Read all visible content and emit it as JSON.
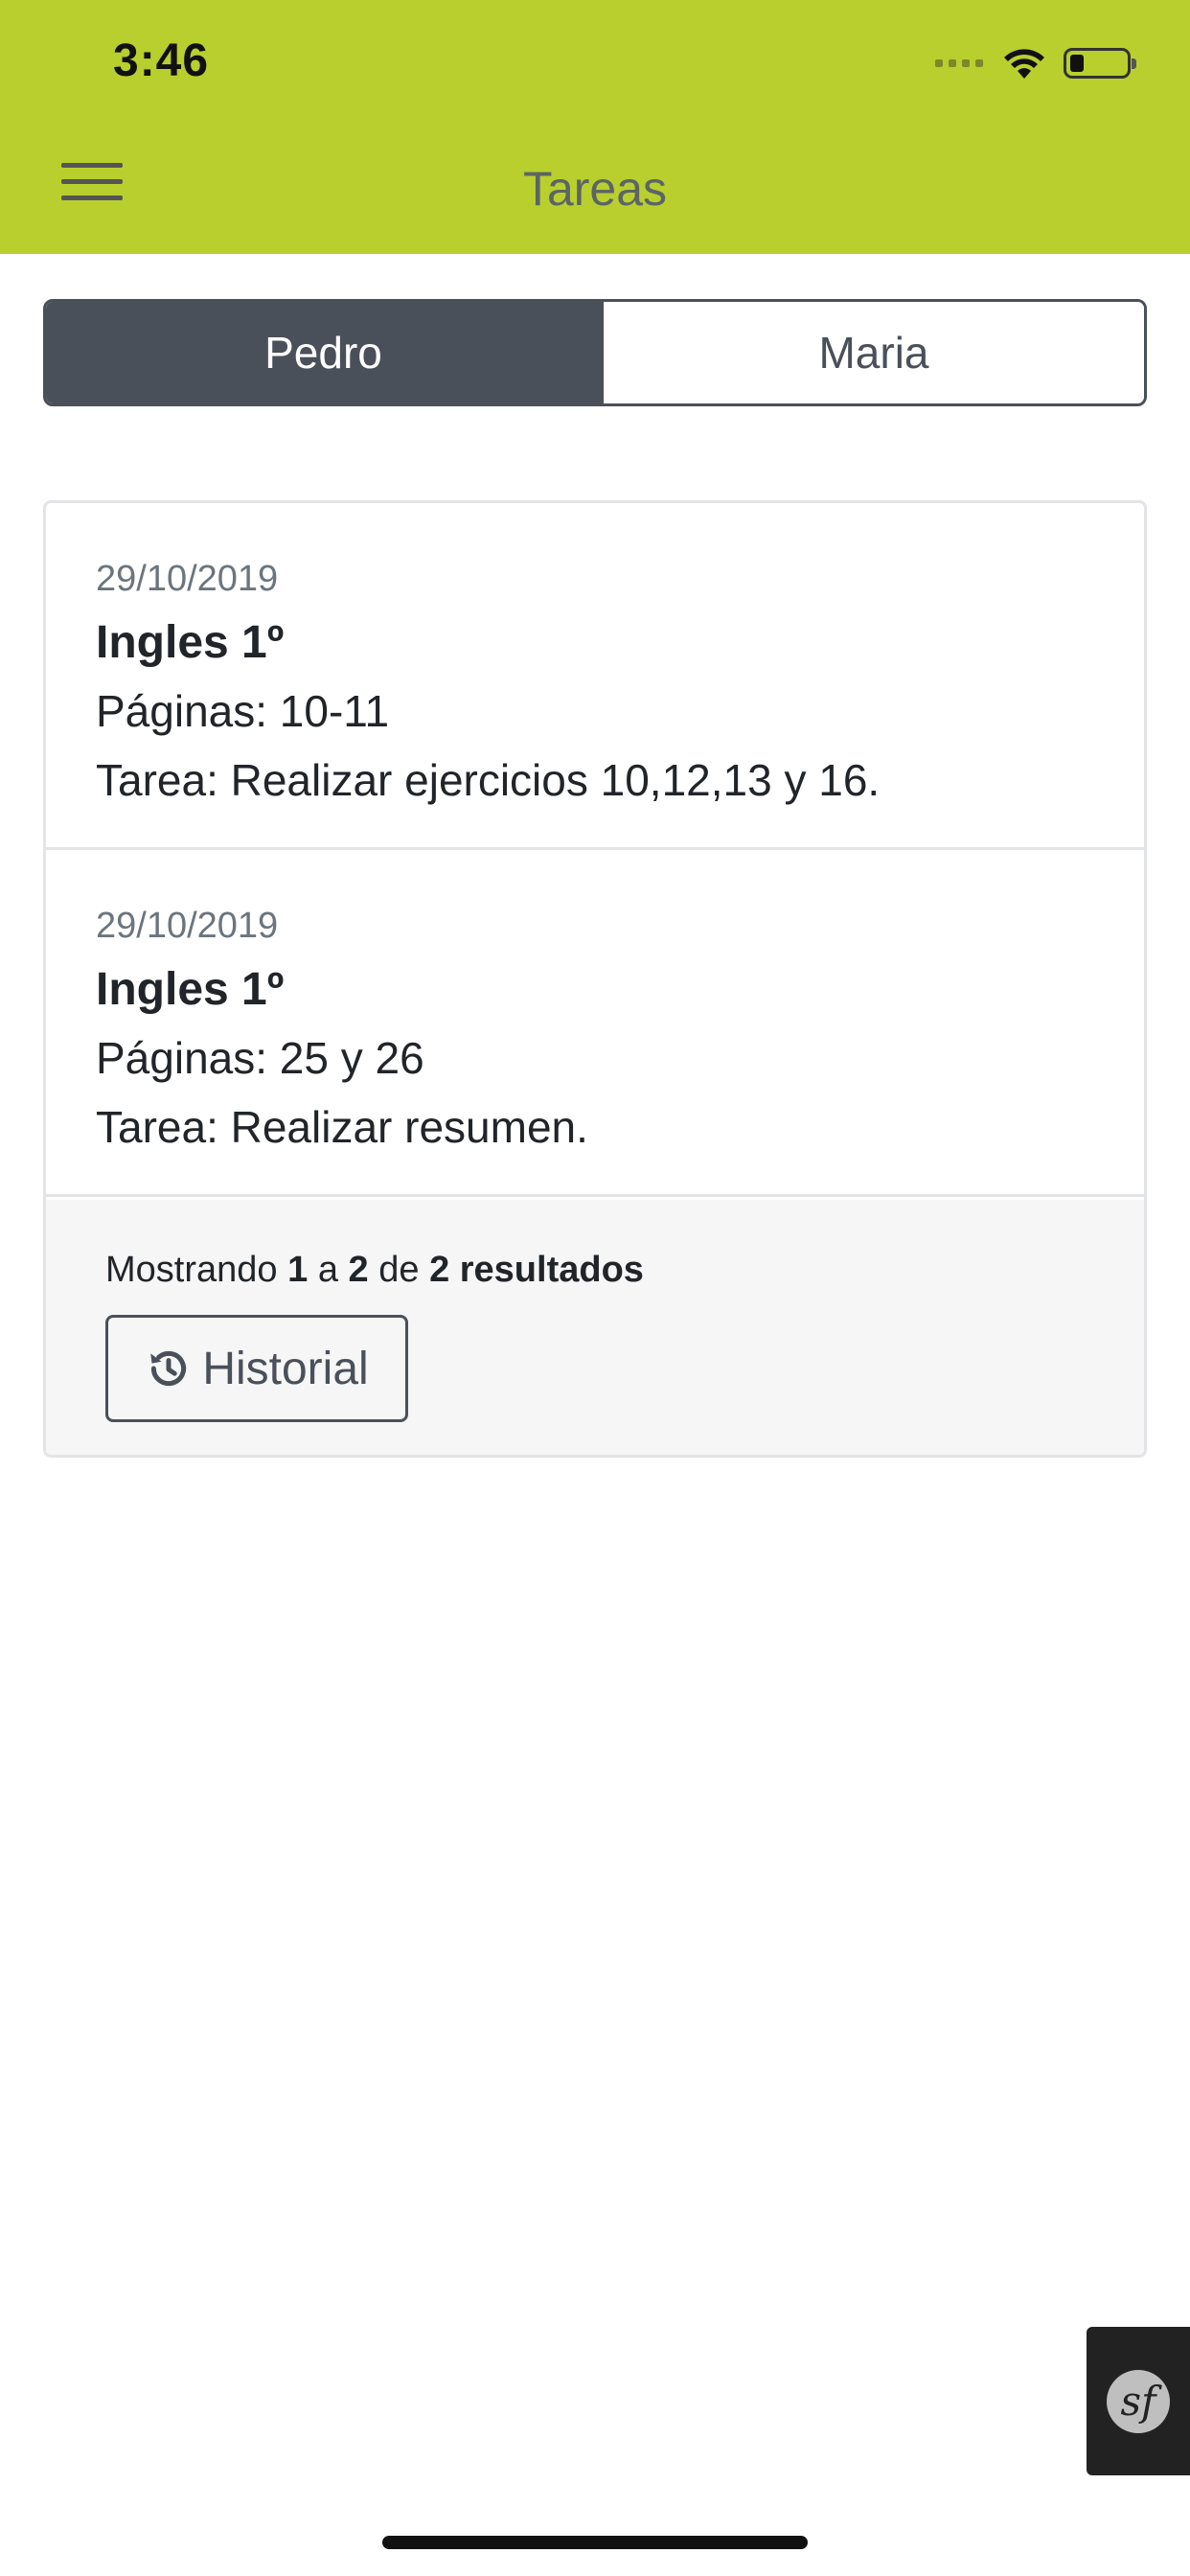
{
  "status_bar": {
    "time": "3:46"
  },
  "header": {
    "title": "Tareas",
    "menu_icon": "hamburger-icon"
  },
  "tabs": [
    {
      "label": "Pedro",
      "active": true
    },
    {
      "label": "Maria",
      "active": false
    }
  ],
  "tasks": [
    {
      "date": "29/10/2019",
      "subject": "Ingles 1º",
      "pages": "Páginas: 10-11",
      "task": "Tarea: Realizar ejercicios 10,12,13 y 16."
    },
    {
      "date": "29/10/2019",
      "subject": "Ingles 1º",
      "pages": "Páginas: 25 y 26",
      "task": "Tarea: Realizar resumen."
    }
  ],
  "pagination": {
    "prefix": "Mostrando",
    "from": "1",
    "sep1": "a",
    "to": "2",
    "sep2": "de",
    "total": "2 resultados"
  },
  "history_button": {
    "label": "Historial",
    "icon": "history-icon"
  },
  "debug_badge": {
    "icon": "symfony-icon",
    "glyph": "sf"
  },
  "colors": {
    "header_bg": "#b8cf2e",
    "tab_active_bg": "#4a505a",
    "card_border": "#e2e4e7",
    "footer_bg": "#f6f6f7"
  }
}
